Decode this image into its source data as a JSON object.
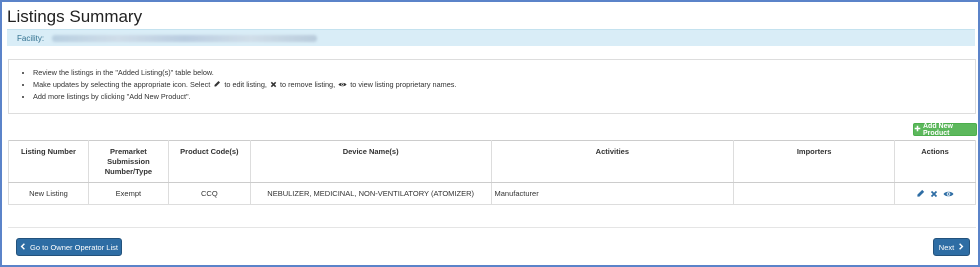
{
  "page": {
    "title": "Listings Summary"
  },
  "facility": {
    "label": "Facility:"
  },
  "instructions": {
    "line1": "Review the listings in the \"Added Listing(s)\" table below.",
    "line2_a": "Make updates by selecting the appropriate icon. Select",
    "line2_b": "to edit listing,",
    "line2_c": "to remove listing,",
    "line2_d": "to view listing proprietary names.",
    "line3": "Add more listings by clicking \"Add New Product\"."
  },
  "add_button": {
    "icon": "plus-icon",
    "label": "Add New Product"
  },
  "table": {
    "headers": {
      "listing_number": "Listing Number",
      "premarket_1": "Premarket",
      "premarket_2": "Submission",
      "premarket_3": "Number/Type",
      "product_codes": "Product Code(s)",
      "device_names": "Device Name(s)",
      "activities": "Activities",
      "importers": "Importers",
      "actions": "Actions"
    },
    "rows": [
      {
        "listing_number": "New Listing",
        "premarket": "Exempt",
        "product_code": "CCQ",
        "device_name": "NEBULIZER, MEDICINAL, NON-VENTILATORY (ATOMIZER)",
        "activities": "Manufacturer",
        "importers": ""
      }
    ]
  },
  "footer": {
    "back_label": "Go to Owner Operator List",
    "next_label": "Next"
  },
  "colors": {
    "primary": "#2e6da4",
    "success": "#5cb85c",
    "info_bg": "#d9edf7",
    "frame": "#5b83c9"
  }
}
